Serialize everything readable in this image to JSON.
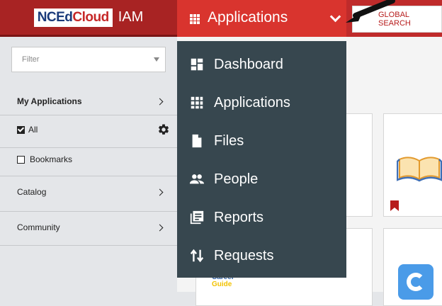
{
  "header": {
    "logo_nced": "NCEd",
    "logo_cloud": "Cloud",
    "logo_iam": "IAM",
    "apps_label": "Applications",
    "global_search": "GLOBAL SEARCH"
  },
  "sidebar": {
    "filter_placeholder": "Filter",
    "my_applications": "My Applications",
    "all": "All",
    "bookmarks": "Bookmarks",
    "catalog": "Catalog",
    "community": "Community"
  },
  "menu": {
    "items": [
      {
        "label": "Dashboard",
        "icon": "dashboard-icon"
      },
      {
        "label": "Applications",
        "icon": "grid-icon"
      },
      {
        "label": "Files",
        "icon": "file-icon"
      },
      {
        "label": "People",
        "icon": "people-icon"
      },
      {
        "label": "Reports",
        "icon": "reports-icon"
      },
      {
        "label": "Requests",
        "icon": "requests-icon"
      }
    ]
  },
  "cards": {
    "career_line1": "Career",
    "career_line2": "Guide"
  },
  "colors": {
    "header_red": "#bf2b2b",
    "apps_tab": "#d9342e",
    "menu_bg": "#37474f",
    "bookmark_red": "#b71c1c"
  }
}
